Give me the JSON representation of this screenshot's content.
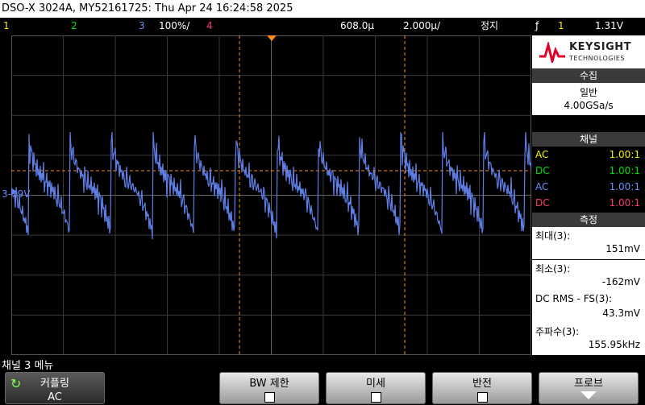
{
  "titlebar": {
    "text": "DSO-X 3024A, MY52161725: Thu Apr 24 16:24:58 2025"
  },
  "topbar": {
    "ch1": "1",
    "ch2": "2",
    "ch3": "3",
    "ch3_scale": "100%/",
    "ch4": "4",
    "delay": "608.0µ",
    "timebase": "2.000µ/",
    "mode": "정지",
    "trigger_icon": "ƒ",
    "trigger_ch": "1",
    "trigger_level": "1.31V"
  },
  "screen": {
    "ch3_marker": "3",
    "ch3_offset": "-19V"
  },
  "logo": {
    "brand": "KEYSIGHT",
    "sub": "TECHNOLOGIES"
  },
  "acquire": {
    "heading": "수집",
    "mode": "일반",
    "rate": "4.00GSa/s"
  },
  "channels": {
    "heading": "채널",
    "rows": [
      {
        "coupling": "AC",
        "probe": "1.00:1",
        "color": "#f2f200"
      },
      {
        "coupling": "DC",
        "probe": "1.00:1",
        "color": "#00e000"
      },
      {
        "coupling": "AC",
        "probe": "1.00:1",
        "color": "#6b8cff"
      },
      {
        "coupling": "DC",
        "probe": "1.00:1",
        "color": "#ff3a6a"
      }
    ]
  },
  "measure": {
    "heading": "측정",
    "items": [
      {
        "label": "최대(3):",
        "value": "151mV"
      },
      {
        "label": "최소(3):",
        "value": "-162mV"
      },
      {
        "label": "DC RMS - FS(3):",
        "value": "43.3mV"
      },
      {
        "label": "주파수(3):",
        "value": "155.95kHz"
      }
    ]
  },
  "menu": {
    "title": "채널 3 메뉴"
  },
  "softkeys": {
    "coupling_label": "커플링",
    "coupling_value": "AC",
    "bw_label": "BW 제한",
    "fine_label": "미세",
    "invert_label": "반전",
    "probe_label": "프로브"
  },
  "colors": {
    "ch3_trace": "#5f7fe8",
    "orange": "#ff8c1a",
    "grid": "#3a3a3a"
  }
}
